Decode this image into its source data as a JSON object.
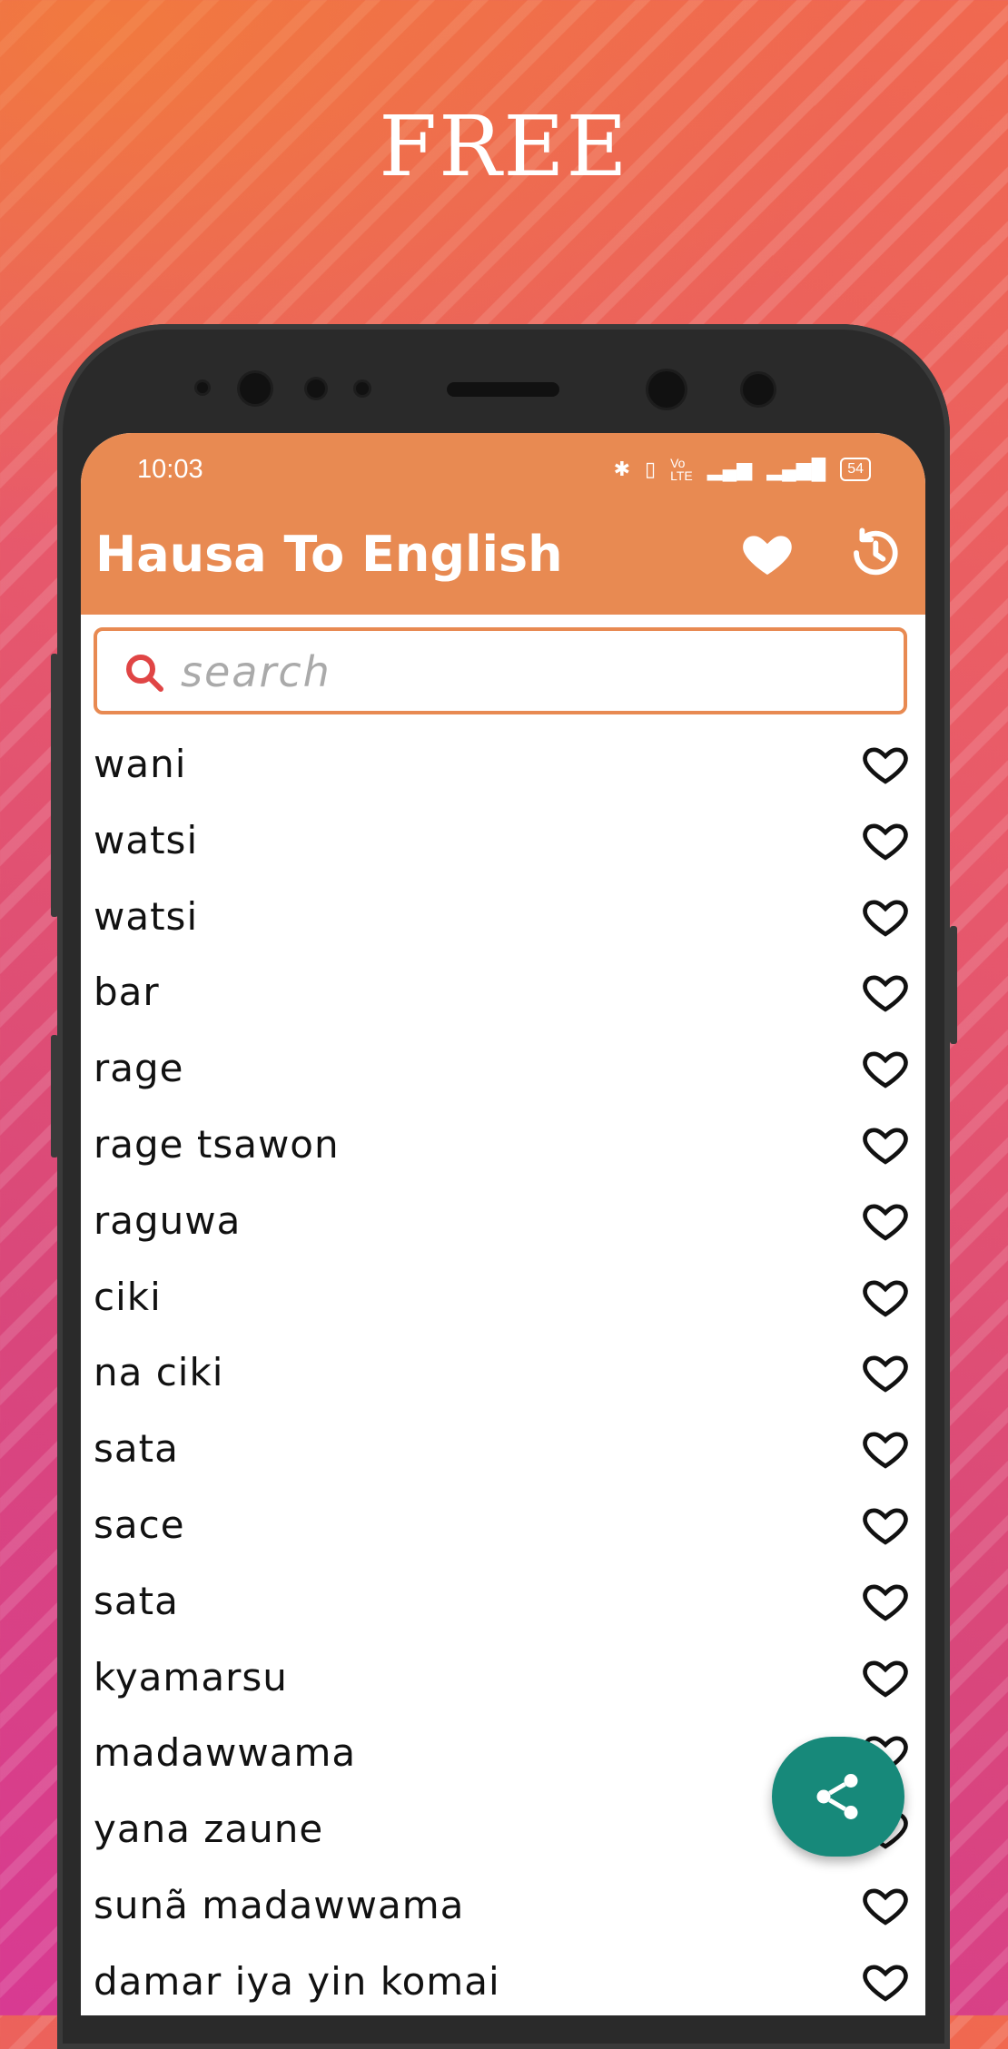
{
  "promo": {
    "headline": "FREE"
  },
  "status_bar": {
    "time": "10:03",
    "icons": [
      "bluetooth-icon",
      "vibrate-icon",
      "volte-icon",
      "signal-icon",
      "signal-roaming-icon"
    ],
    "battery": "54"
  },
  "app": {
    "title": "Hausa To English",
    "favorites_icon": "heart-filled-icon",
    "history_icon": "history-icon",
    "accent_color": "#e88a52",
    "fab_color": "#17897a"
  },
  "search": {
    "placeholder": "search"
  },
  "words": [
    {
      "label": "wani"
    },
    {
      "label": "watsi"
    },
    {
      "label": "watsi"
    },
    {
      "label": "bar"
    },
    {
      "label": "rage"
    },
    {
      "label": "rage tsawon"
    },
    {
      "label": "raguwa"
    },
    {
      "label": "ciki"
    },
    {
      "label": "na ciki"
    },
    {
      "label": "sata"
    },
    {
      "label": "sace"
    },
    {
      "label": "sata"
    },
    {
      "label": "kyamarsu"
    },
    {
      "label": "madawwama"
    },
    {
      "label": "yana zaune"
    },
    {
      "label": "sunã madawwama"
    },
    {
      "label": "damar iya yin komai"
    }
  ],
  "fab": {
    "icon": "share-icon"
  }
}
